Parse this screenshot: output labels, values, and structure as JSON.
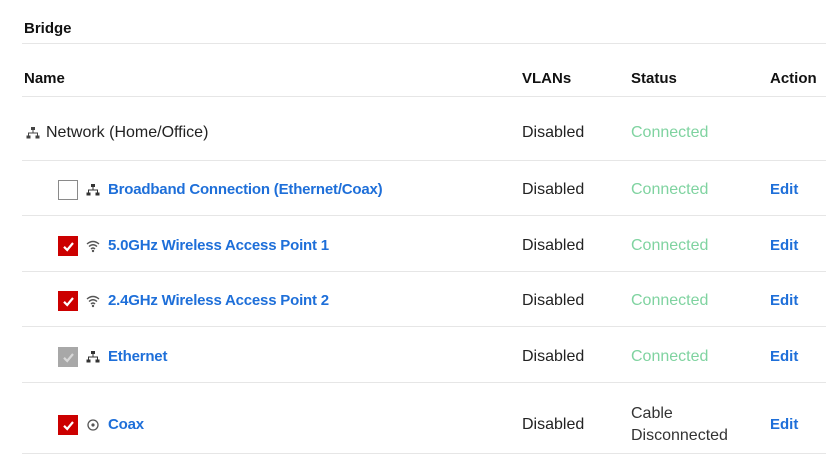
{
  "section": {
    "title": "Bridge"
  },
  "table": {
    "headers": {
      "name": "Name",
      "vlans": "VLANs",
      "status": "Status",
      "action": "Action"
    },
    "parent": {
      "name": "Network (Home/Office)",
      "vlans": "Disabled",
      "status": "Connected",
      "icon": "network-icon"
    },
    "rows": [
      {
        "name": "Broadband Connection (Ethernet/Coax)",
        "vlans": "Disabled",
        "status": "Connected",
        "action": "Edit",
        "checkbox": "unchecked",
        "icon": "network-icon"
      },
      {
        "name": "5.0GHz Wireless Access Point 1",
        "vlans": "Disabled",
        "status": "Connected",
        "action": "Edit",
        "checkbox": "checked",
        "icon": "wifi-icon"
      },
      {
        "name": "2.4GHz Wireless Access Point 2",
        "vlans": "Disabled",
        "status": "Connected",
        "action": "Edit",
        "checkbox": "checked",
        "icon": "wifi-icon"
      },
      {
        "name": "Ethernet",
        "vlans": "Disabled",
        "status": "Connected",
        "action": "Edit",
        "checkbox": "disabled-checked",
        "icon": "network-icon"
      },
      {
        "name": "Coax",
        "vlans": "Disabled",
        "status_line1": "Cable",
        "status_line2": "Disconnected",
        "action": "Edit",
        "checkbox": "checked",
        "icon": "coax-icon"
      }
    ]
  },
  "colors": {
    "link": "#1e6fd9",
    "connected": "#7fd3a0",
    "checkbox_checked": "#cc0000",
    "checkbox_disabled": "#a8a8a8"
  }
}
